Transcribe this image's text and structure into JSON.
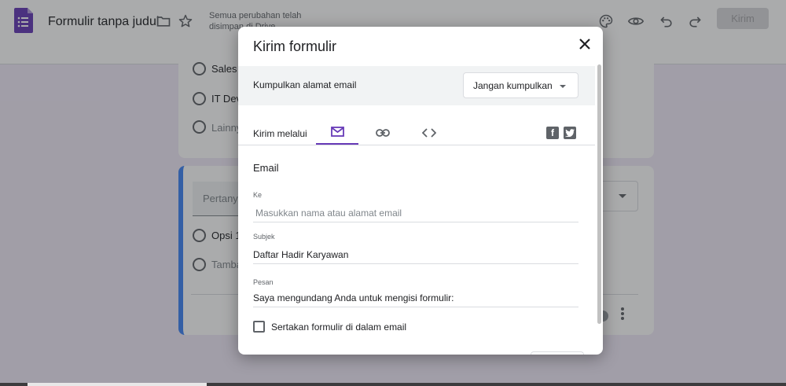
{
  "header": {
    "title": "Formulir tanpa judul",
    "saved_status": "Semua perubahan telah disimpan di Drive",
    "send_label": "Kirim",
    "icons": [
      "forms-app-icon",
      "folder-icon",
      "star-icon",
      "palette-icon",
      "eye-icon",
      "undo-icon",
      "redo-icon"
    ]
  },
  "form": {
    "card1": {
      "options": [
        "Sales",
        "IT Deve",
        "Lainny"
      ]
    },
    "card2": {
      "question_placeholder": "Pertany",
      "options": [
        "Opsi 1",
        "Tamba"
      ]
    }
  },
  "dialog": {
    "title": "Kirim formulir",
    "collect_email_label": "Kumpulkan alamat email",
    "collect_email_value": "Jangan kumpulkan",
    "send_via_label": "Kirim melalui",
    "tabs": [
      "email-icon",
      "link-icon",
      "embed-icon"
    ],
    "active_tab": "email-icon",
    "social": [
      "facebook-icon",
      "twitter-icon"
    ],
    "section_title": "Email",
    "to_label": "Ke",
    "to_placeholder": "Masukkan nama atau alamat email",
    "subject_label": "Subjek",
    "subject_value": "Daftar Hadir Karyawan",
    "message_label": "Pesan",
    "message_value": "Saya mengundang Anda untuk mengisi formulir:",
    "include_form_label": "Sertakan formulir di dalam email",
    "include_form_checked": false
  },
  "colors": {
    "accent": "#673ab7",
    "card_focus": "#4285f4",
    "page_bg": "#f0ebf8"
  }
}
